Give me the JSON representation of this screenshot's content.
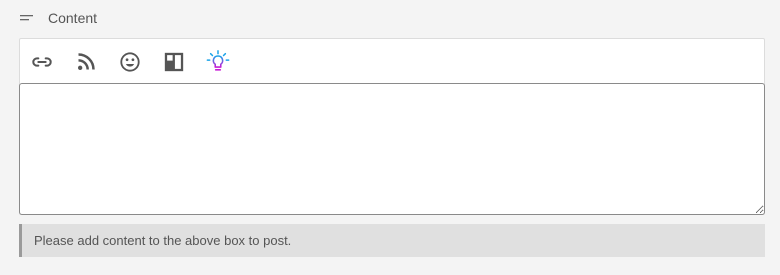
{
  "header": {
    "title": "Content",
    "icon": "menu-lines-icon"
  },
  "toolbar": {
    "buttons": [
      {
        "icon": "link-icon",
        "color": "#555555"
      },
      {
        "icon": "rss-icon",
        "color": "#555555"
      },
      {
        "icon": "smiley-icon",
        "color": "#555555"
      },
      {
        "icon": "layout-icon",
        "color": "#555555"
      },
      {
        "icon": "lightbulb-icon",
        "color": "#7b3fe4"
      }
    ]
  },
  "editor": {
    "value": "",
    "placeholder": ""
  },
  "notice": {
    "text": "Please add content to the above box to post."
  }
}
